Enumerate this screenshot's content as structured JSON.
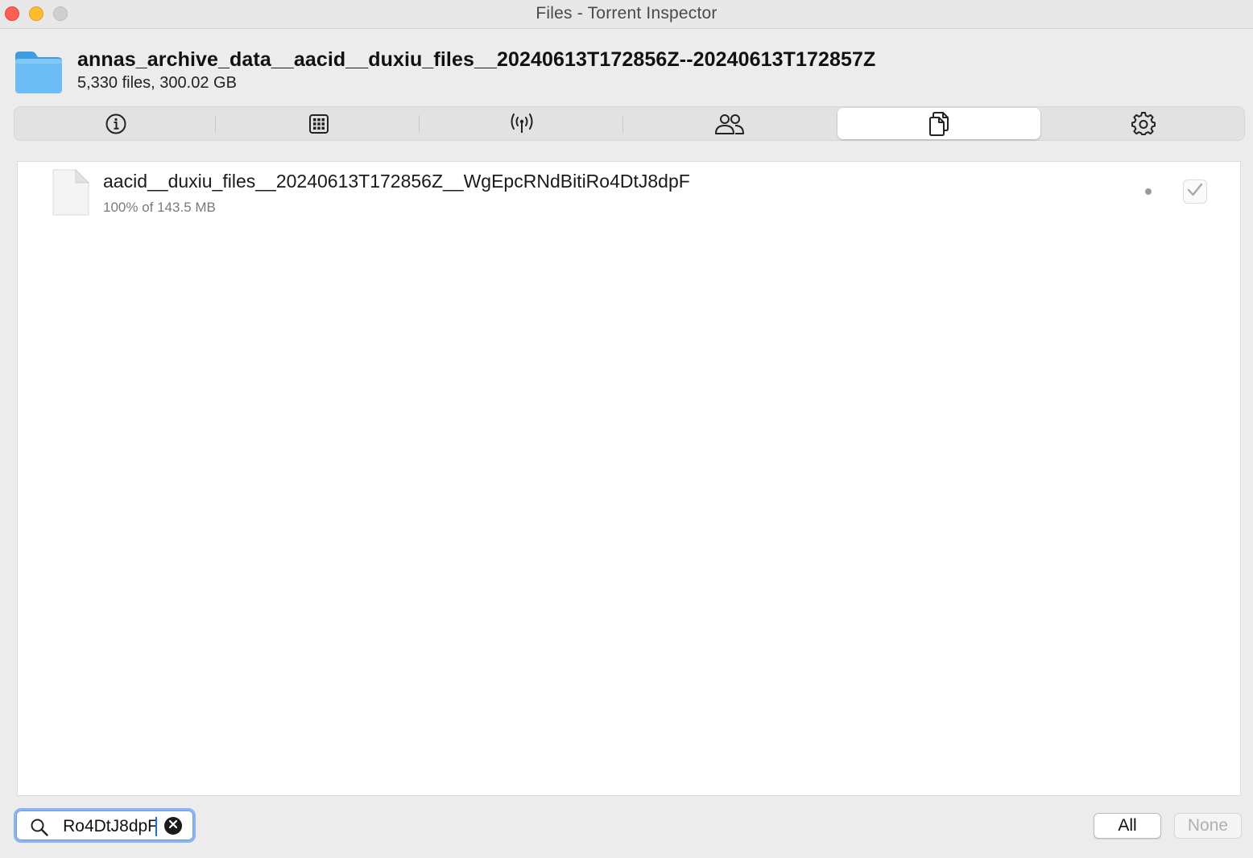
{
  "window": {
    "title": "Files - Torrent Inspector"
  },
  "header": {
    "torrent_name": "annas_archive_data__aacid__duxiu_files__20240613T172856Z--20240613T172857Z",
    "summary": "5,330 files, 300.02 GB",
    "icon": "folder-icon"
  },
  "tabs": [
    {
      "id": "info",
      "icon": "info-icon",
      "selected": false
    },
    {
      "id": "activity",
      "icon": "pieces-grid-icon",
      "selected": false
    },
    {
      "id": "trackers",
      "icon": "antenna-icon",
      "selected": false
    },
    {
      "id": "peers",
      "icon": "peers-icon",
      "selected": false
    },
    {
      "id": "files",
      "icon": "files-icon",
      "selected": true
    },
    {
      "id": "options",
      "icon": "gear-icon",
      "selected": false
    }
  ],
  "files": [
    {
      "name": "aacid__duxiu_files__20240613T172856Z__WgEpcRNdBitiRo4DtJ8dpF",
      "progress_text": "100% of 143.5 MB",
      "progress": 1.0,
      "checked": true,
      "icon": "document-icon"
    }
  ],
  "search": {
    "value": "Ro4DtJ8dpF",
    "icon": "magnifying-glass-icon"
  },
  "buttons": {
    "all_label": "All",
    "none_label": "None"
  },
  "colors": {
    "accent": "#1a6cf5",
    "focus_ring": "#8cb4f2",
    "folder": "#5eb3f0",
    "close": "#fe5f57",
    "minimize": "#febc2e"
  }
}
